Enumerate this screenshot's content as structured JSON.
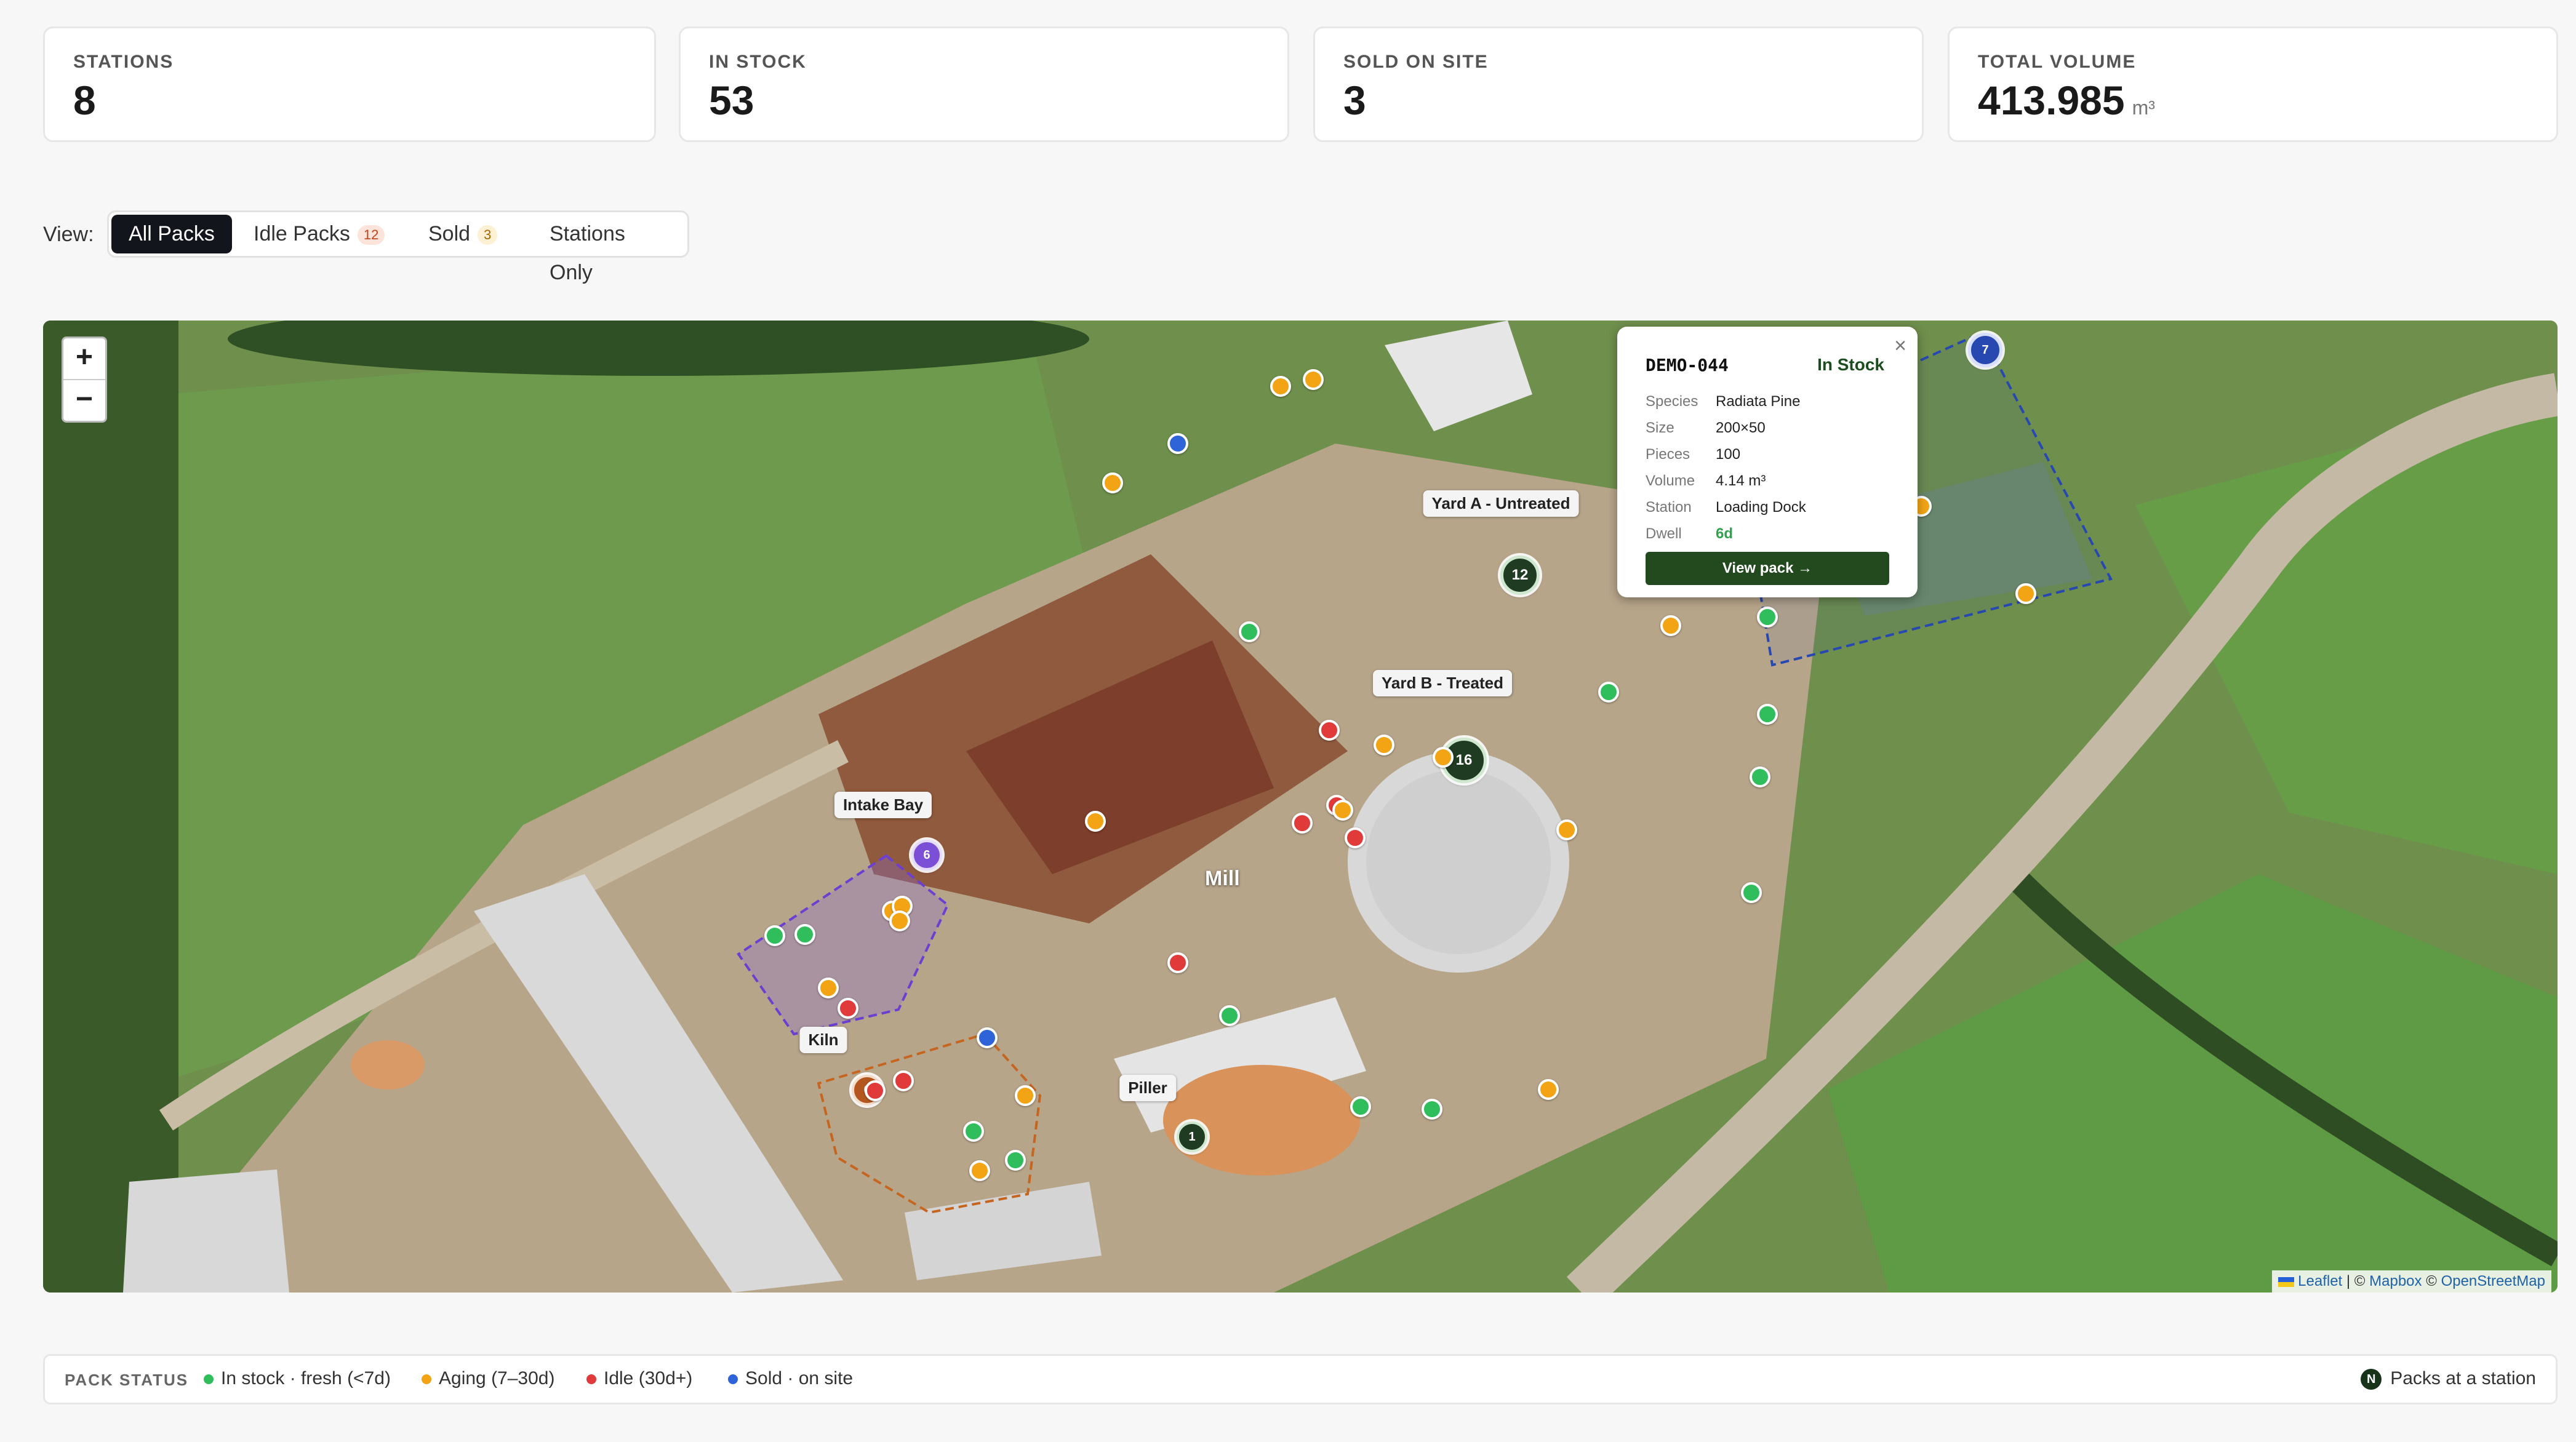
{
  "stats": [
    {
      "label": "STATIONS",
      "value": "8",
      "unit": ""
    },
    {
      "label": "IN STOCK",
      "value": "53",
      "unit": ""
    },
    {
      "label": "SOLD ON SITE",
      "value": "3",
      "unit": ""
    },
    {
      "label": "TOTAL VOLUME",
      "value": "413.985",
      "unit": "m³"
    }
  ],
  "view": {
    "label": "View:",
    "options": [
      {
        "label": "All Packs",
        "badge": ""
      },
      {
        "label": "Idle Packs",
        "badge": "12"
      },
      {
        "label": "Sold",
        "badge": "3"
      },
      {
        "label": "Stations Only",
        "badge": ""
      }
    ],
    "active": "All Packs"
  },
  "map": {
    "zoom_in": "+",
    "zoom_out": "−",
    "place_label": "Mill",
    "attribution": {
      "leaflet": "Leaflet",
      "sep1": " | © ",
      "mapbox": "Mapbox",
      "sep2": " © ",
      "osm": "OpenStreetMap"
    },
    "stations": [
      {
        "name": "Yard A - Untreated",
        "count": "12",
        "color": "#1f3b22"
      },
      {
        "name": "Yard B - Treated",
        "count": "16",
        "color": "#1f3b22"
      },
      {
        "name": "Intake Bay",
        "count": "6",
        "color": "#7b4fd6"
      },
      {
        "name": "Kiln",
        "count": "6",
        "color": "#b3571f"
      },
      {
        "name": "Piller",
        "count": "1",
        "color": "#1f3b22"
      },
      {
        "name": "",
        "count": "7",
        "color": "#2748b0"
      }
    ]
  },
  "popup": {
    "pack_id": "DEMO-044",
    "status": "In Stock",
    "close": "×",
    "fields": [
      {
        "key": "Species",
        "value": "Radiata Pine"
      },
      {
        "key": "Size",
        "value": "200×50"
      },
      {
        "key": "Pieces",
        "value": "100"
      },
      {
        "key": "Volume",
        "value": "4.14 m³"
      },
      {
        "key": "Station",
        "value": "Loading Dock"
      },
      {
        "key": "Dwell",
        "value": "6d"
      }
    ],
    "button": "View pack →"
  },
  "legend": {
    "title": "PACK STATUS",
    "items": [
      {
        "label": "In stock · fresh (<7d)",
        "color": "#2fbe5b"
      },
      {
        "label": "Aging (7–30d)",
        "color": "#f2a415"
      },
      {
        "label": "Idle (30d+)",
        "color": "#e03a3a"
      },
      {
        "label": "Sold · on site",
        "color": "#2f63d8"
      }
    ],
    "station_badge": "N",
    "station_label": "Packs at a station"
  },
  "colors": {
    "accent": "#12161c",
    "fresh": "#2fbe5b",
    "aging": "#f2a415",
    "idle": "#e03a3a",
    "sold": "#2f63d8",
    "station": "#1f3b22"
  }
}
